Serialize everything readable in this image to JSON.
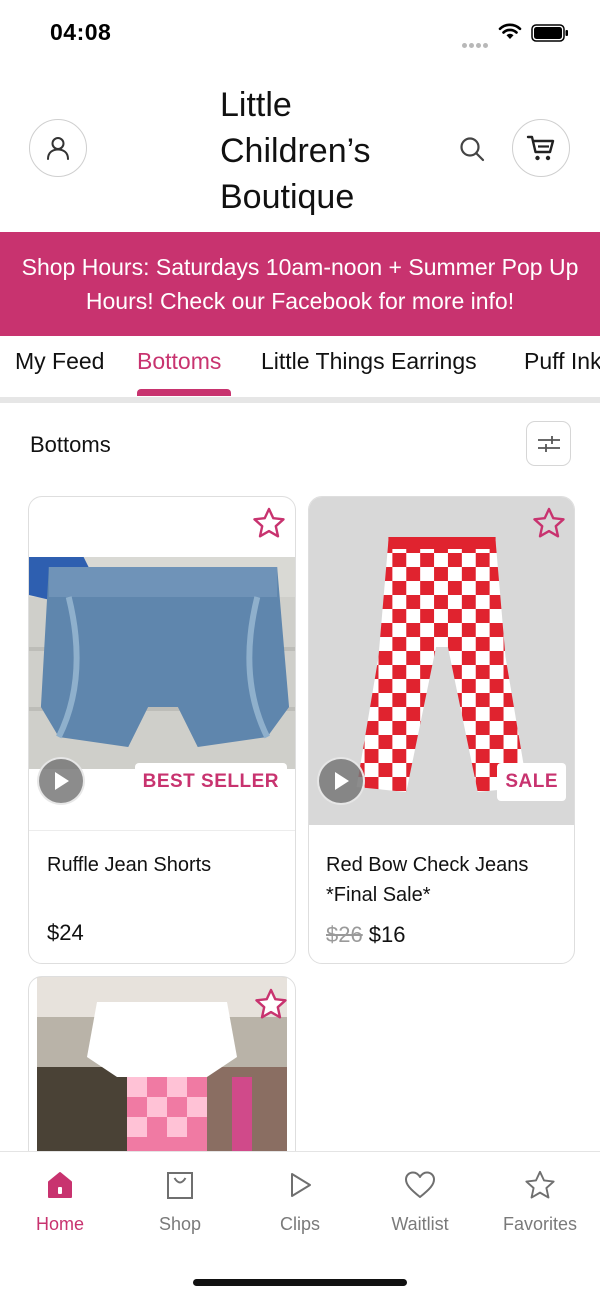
{
  "status_bar": {
    "time": "04:08"
  },
  "header": {
    "store_name": "Little Children’s Boutique"
  },
  "banner": {
    "text": "Shop Hours: Saturdays 10am-noon + Summer Pop Up Hours!  Check our Facebook for more info!"
  },
  "tabs": [
    {
      "label": "My Feed",
      "active": false
    },
    {
      "label": "Bottoms",
      "active": true
    },
    {
      "label": "Little Things Earrings",
      "active": false
    },
    {
      "label": "Puff Ink",
      "active": false
    }
  ],
  "section": {
    "title": "Bottoms"
  },
  "products": [
    {
      "name": "Ruffle Jean Shorts",
      "price": "$24",
      "badge": "BEST SELLER"
    },
    {
      "name": "Red Bow Check Jeans *Final Sale*",
      "old_price": "$26",
      "price": "$16",
      "badge": "SALE"
    },
    {
      "name": "",
      "price": ""
    }
  ],
  "bottom_nav": [
    {
      "label": "Home",
      "icon": "home-icon",
      "active": true
    },
    {
      "label": "Shop",
      "icon": "shopping-bag-icon",
      "active": false
    },
    {
      "label": "Clips",
      "icon": "play-icon",
      "active": false
    },
    {
      "label": "Waitlist",
      "icon": "heart-icon",
      "active": false
    },
    {
      "label": "Favorites",
      "icon": "star-icon",
      "active": false
    }
  ],
  "colors": {
    "accent": "#c8336f",
    "muted": "#7a7a7a"
  }
}
